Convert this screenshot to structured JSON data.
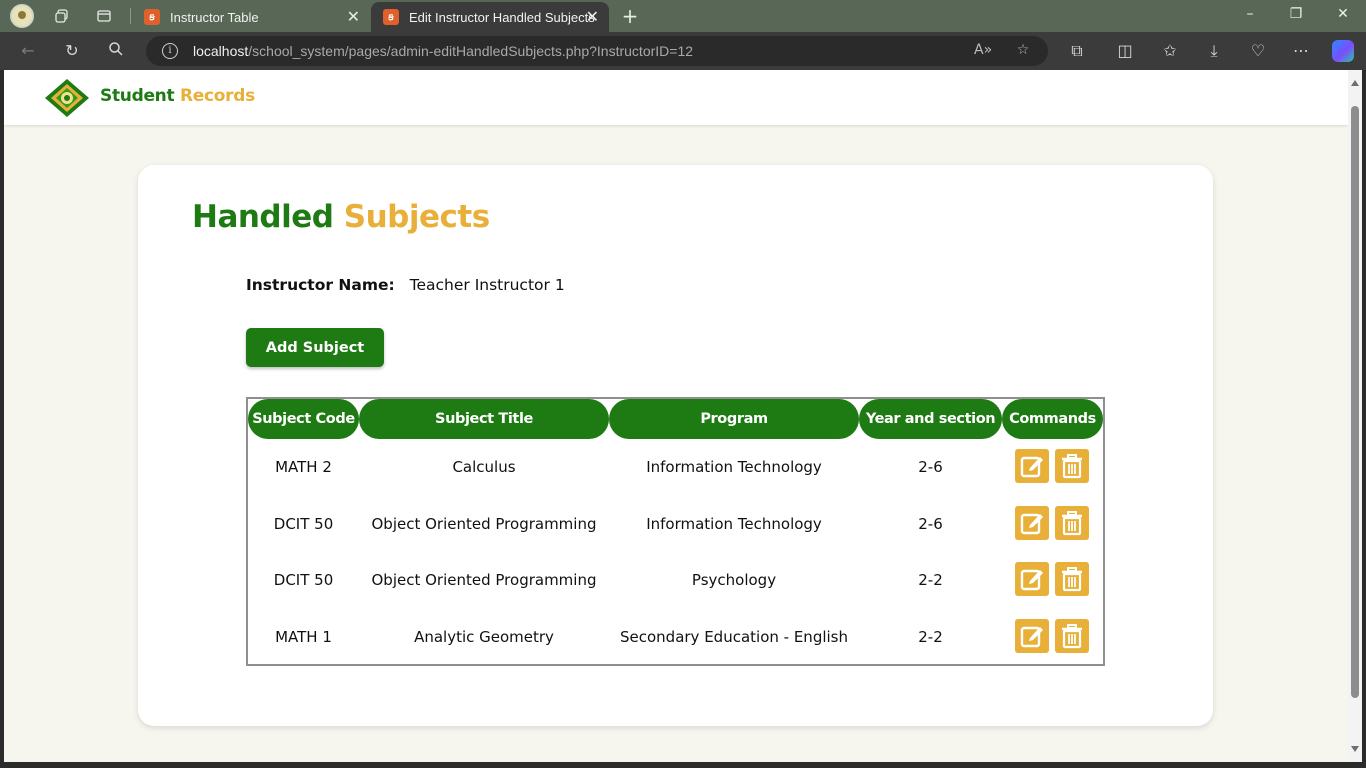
{
  "browser": {
    "tabs": [
      {
        "title": "Instructor Table",
        "active": false
      },
      {
        "title": "Edit Instructor Handled Subjects",
        "active": true
      }
    ],
    "url": {
      "host": "localhost",
      "path": "/school_system/pages/admin-editHandledSubjects.php?InstructorID=12"
    }
  },
  "site": {
    "brand_primary": "Student",
    "brand_secondary": "Records"
  },
  "page": {
    "title_primary": "Handled",
    "title_secondary": "Subjects",
    "instructor_label": "Instructor Name:",
    "instructor_name": "Teacher Instructor 1",
    "add_button": "Add Subject"
  },
  "table": {
    "headers": [
      "Subject Code",
      "Subject Title",
      "Program",
      "Year and section",
      "Commands"
    ],
    "rows": [
      {
        "code": "MATH 2",
        "title": "Calculus",
        "program": "Information Technology",
        "section": "2-6"
      },
      {
        "code": "DCIT 50",
        "title": "Object Oriented Programming",
        "program": "Information Technology",
        "section": "2-6"
      },
      {
        "code": "DCIT 50",
        "title": "Object Oriented Programming",
        "program": "Psychology",
        "section": "2-2"
      },
      {
        "code": "MATH 1",
        "title": "Analytic Geometry",
        "program": "Secondary Education - English",
        "section": "2-2"
      }
    ],
    "commands": [
      "edit-icon",
      "trash-icon"
    ]
  },
  "colors": {
    "green": "#1e7a13",
    "gold": "#e8b039",
    "page_bg": "#f6f5ee",
    "card_bg": "#ffffff"
  }
}
